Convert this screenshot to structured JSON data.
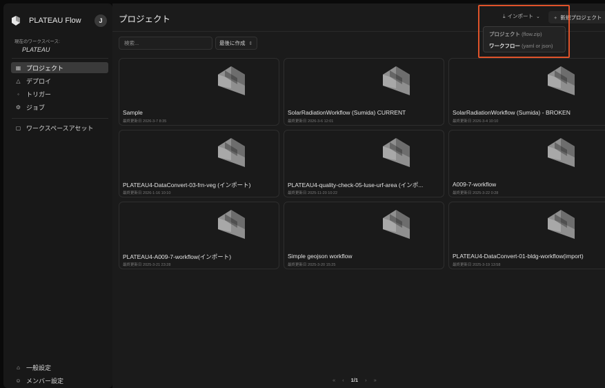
{
  "brand": {
    "name": "PLATEAU Flow",
    "avatar_initial": "J"
  },
  "workspace": {
    "label": "現在のワークスペース:",
    "name": "PLATEAU"
  },
  "nav": [
    {
      "icon": "grid-icon",
      "glyph": "▦",
      "label": "プロジェクト",
      "active": true
    },
    {
      "icon": "deploy-icon",
      "glyph": "△",
      "label": "デプロイ",
      "active": false
    },
    {
      "icon": "trigger-icon",
      "glyph": "◦",
      "label": "トリガー",
      "active": false
    },
    {
      "icon": "jobs-icon",
      "glyph": "⚙",
      "label": "ジョブ",
      "active": false
    }
  ],
  "assets": {
    "icon": "file-icon",
    "glyph": "▢",
    "label": "ワークスペースアセット"
  },
  "bottom_nav": [
    {
      "icon": "settings-icon",
      "glyph": "⌂",
      "label": "一般設定"
    },
    {
      "icon": "members-icon",
      "glyph": "☺",
      "label": "メンバー設定"
    }
  ],
  "header": {
    "title": "プロジェクト",
    "import_label": "インポート",
    "new_label": "新規プロジェクト"
  },
  "import_menu": [
    {
      "label": "プロジェクト",
      "sub": "(flow.zip)",
      "disabled": true
    },
    {
      "label": "ワークフロー",
      "sub": "(yaml or json)",
      "disabled": false
    }
  ],
  "search": {
    "placeholder": "検索..."
  },
  "sort": {
    "value": "最後に作成"
  },
  "projects": [
    {
      "name": "Sample",
      "updated": "最終更新日 2026-3-7 8:35"
    },
    {
      "name": "SolarRadiationWorkflow (Sumida) CURRENT",
      "updated": "最終更新日 2026-3-6 12:01"
    },
    {
      "name": "SolarRadiationWorkflow (Sumida) - BROKEN",
      "updated": "最終更新日 2026-3-4 10:10"
    },
    {
      "name": "PLATEAU4-DataConvert-03-frn-veg (インポート)",
      "updated": "最終更新日 2026-1-16 10:10"
    },
    {
      "name": "PLATEAU4-quality-check-05-luse-urf-area (インポ...",
      "updated": "最終更新日 2025-11-20 10:22"
    },
    {
      "name": "A009-7-workflow",
      "updated": "最終更新日 2025-3-22 0:28"
    },
    {
      "name": "PLATEAU4-A009-7-workflow(インポート)",
      "updated": "最終更新日 2025-3-21 23:28"
    },
    {
      "name": "Simple geojson workflow",
      "updated": "最終更新日 2025-3-20 15:25"
    },
    {
      "name": "PLATEAU4-DataConvert-01-bldg-workflow(import)",
      "updated": "最終更新日 2025-3-19 13:58"
    }
  ],
  "pagination": {
    "first": "«",
    "prev": "‹",
    "current": "1/1",
    "next": "›",
    "last": "»"
  },
  "colors": {
    "highlight": "#e0532a",
    "sidebar": "#181818",
    "main": "#1b1b1b"
  }
}
